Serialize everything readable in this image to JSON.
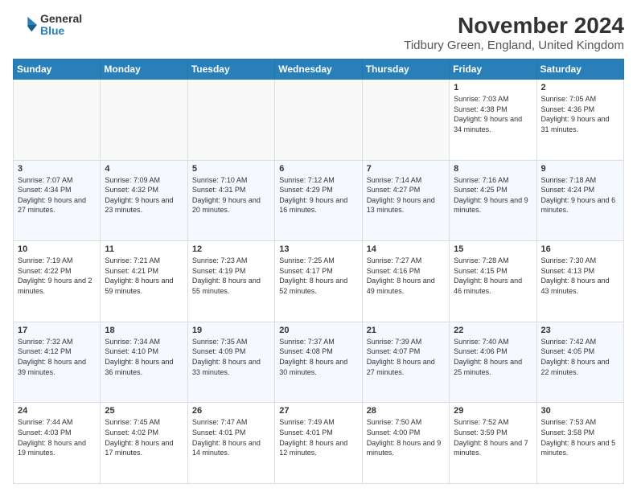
{
  "logo": {
    "general": "General",
    "blue": "Blue"
  },
  "title": "November 2024",
  "subtitle": "Tidbury Green, England, United Kingdom",
  "headers": [
    "Sunday",
    "Monday",
    "Tuesday",
    "Wednesday",
    "Thursday",
    "Friday",
    "Saturday"
  ],
  "weeks": [
    [
      {
        "day": "",
        "info": ""
      },
      {
        "day": "",
        "info": ""
      },
      {
        "day": "",
        "info": ""
      },
      {
        "day": "",
        "info": ""
      },
      {
        "day": "",
        "info": ""
      },
      {
        "day": "1",
        "info": "Sunrise: 7:03 AM\nSunset: 4:38 PM\nDaylight: 9 hours and 34 minutes."
      },
      {
        "day": "2",
        "info": "Sunrise: 7:05 AM\nSunset: 4:36 PM\nDaylight: 9 hours and 31 minutes."
      }
    ],
    [
      {
        "day": "3",
        "info": "Sunrise: 7:07 AM\nSunset: 4:34 PM\nDaylight: 9 hours and 27 minutes."
      },
      {
        "day": "4",
        "info": "Sunrise: 7:09 AM\nSunset: 4:32 PM\nDaylight: 9 hours and 23 minutes."
      },
      {
        "day": "5",
        "info": "Sunrise: 7:10 AM\nSunset: 4:31 PM\nDaylight: 9 hours and 20 minutes."
      },
      {
        "day": "6",
        "info": "Sunrise: 7:12 AM\nSunset: 4:29 PM\nDaylight: 9 hours and 16 minutes."
      },
      {
        "day": "7",
        "info": "Sunrise: 7:14 AM\nSunset: 4:27 PM\nDaylight: 9 hours and 13 minutes."
      },
      {
        "day": "8",
        "info": "Sunrise: 7:16 AM\nSunset: 4:25 PM\nDaylight: 9 hours and 9 minutes."
      },
      {
        "day": "9",
        "info": "Sunrise: 7:18 AM\nSunset: 4:24 PM\nDaylight: 9 hours and 6 minutes."
      }
    ],
    [
      {
        "day": "10",
        "info": "Sunrise: 7:19 AM\nSunset: 4:22 PM\nDaylight: 9 hours and 2 minutes."
      },
      {
        "day": "11",
        "info": "Sunrise: 7:21 AM\nSunset: 4:21 PM\nDaylight: 8 hours and 59 minutes."
      },
      {
        "day": "12",
        "info": "Sunrise: 7:23 AM\nSunset: 4:19 PM\nDaylight: 8 hours and 55 minutes."
      },
      {
        "day": "13",
        "info": "Sunrise: 7:25 AM\nSunset: 4:17 PM\nDaylight: 8 hours and 52 minutes."
      },
      {
        "day": "14",
        "info": "Sunrise: 7:27 AM\nSunset: 4:16 PM\nDaylight: 8 hours and 49 minutes."
      },
      {
        "day": "15",
        "info": "Sunrise: 7:28 AM\nSunset: 4:15 PM\nDaylight: 8 hours and 46 minutes."
      },
      {
        "day": "16",
        "info": "Sunrise: 7:30 AM\nSunset: 4:13 PM\nDaylight: 8 hours and 43 minutes."
      }
    ],
    [
      {
        "day": "17",
        "info": "Sunrise: 7:32 AM\nSunset: 4:12 PM\nDaylight: 8 hours and 39 minutes."
      },
      {
        "day": "18",
        "info": "Sunrise: 7:34 AM\nSunset: 4:10 PM\nDaylight: 8 hours and 36 minutes."
      },
      {
        "day": "19",
        "info": "Sunrise: 7:35 AM\nSunset: 4:09 PM\nDaylight: 8 hours and 33 minutes."
      },
      {
        "day": "20",
        "info": "Sunrise: 7:37 AM\nSunset: 4:08 PM\nDaylight: 8 hours and 30 minutes."
      },
      {
        "day": "21",
        "info": "Sunrise: 7:39 AM\nSunset: 4:07 PM\nDaylight: 8 hours and 27 minutes."
      },
      {
        "day": "22",
        "info": "Sunrise: 7:40 AM\nSunset: 4:06 PM\nDaylight: 8 hours and 25 minutes."
      },
      {
        "day": "23",
        "info": "Sunrise: 7:42 AM\nSunset: 4:05 PM\nDaylight: 8 hours and 22 minutes."
      }
    ],
    [
      {
        "day": "24",
        "info": "Sunrise: 7:44 AM\nSunset: 4:03 PM\nDaylight: 8 hours and 19 minutes."
      },
      {
        "day": "25",
        "info": "Sunrise: 7:45 AM\nSunset: 4:02 PM\nDaylight: 8 hours and 17 minutes."
      },
      {
        "day": "26",
        "info": "Sunrise: 7:47 AM\nSunset: 4:01 PM\nDaylight: 8 hours and 14 minutes."
      },
      {
        "day": "27",
        "info": "Sunrise: 7:49 AM\nSunset: 4:01 PM\nDaylight: 8 hours and 12 minutes."
      },
      {
        "day": "28",
        "info": "Sunrise: 7:50 AM\nSunset: 4:00 PM\nDaylight: 8 hours and 9 minutes."
      },
      {
        "day": "29",
        "info": "Sunrise: 7:52 AM\nSunset: 3:59 PM\nDaylight: 8 hours and 7 minutes."
      },
      {
        "day": "30",
        "info": "Sunrise: 7:53 AM\nSunset: 3:58 PM\nDaylight: 8 hours and 5 minutes."
      }
    ]
  ]
}
